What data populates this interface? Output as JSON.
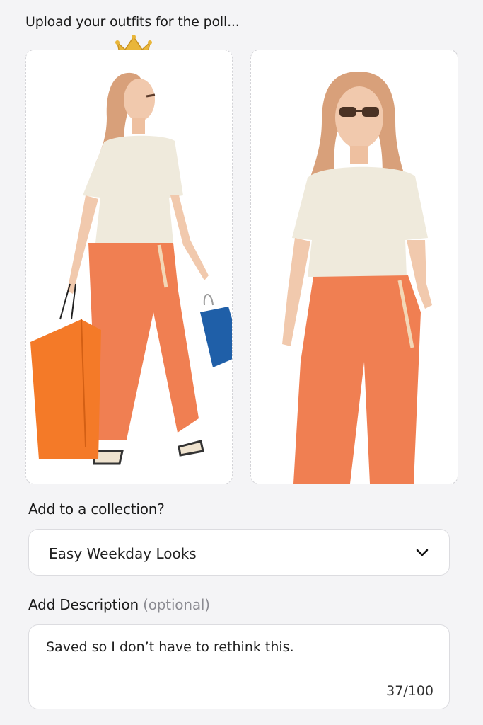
{
  "header": {
    "title": "Upload your outfits for the poll..."
  },
  "outfits": [
    {
      "slot": "left",
      "winner_icon": "crown-icon"
    },
    {
      "slot": "right"
    }
  ],
  "collection": {
    "label": "Add to a collection?",
    "selected": "Easy Weekday Looks"
  },
  "description": {
    "label": "Add Description",
    "optional_label": "(optional)",
    "value": "Saved so I don’t have to rethink this.",
    "counter": "37/100"
  },
  "colors": {
    "pants": "#f07f52",
    "bag_orange": "#f47a28",
    "bag_blue": "#1f5fa8",
    "top": "#efeadc",
    "crown": "#e9b63a"
  }
}
